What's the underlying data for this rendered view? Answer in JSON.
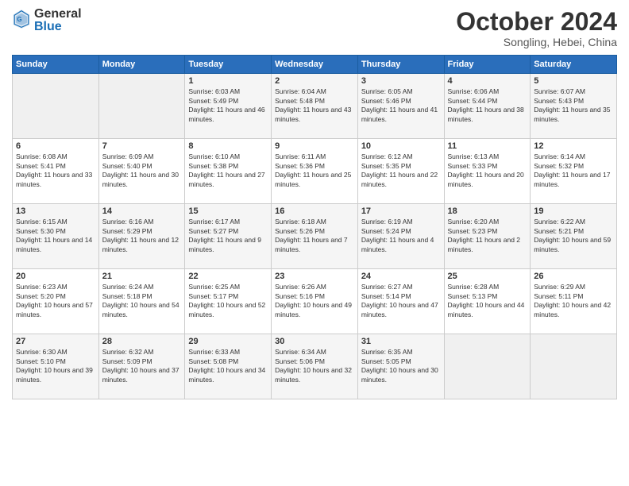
{
  "logo": {
    "general": "General",
    "blue": "Blue"
  },
  "title": "October 2024",
  "location": "Songling, Hebei, China",
  "days_header": [
    "Sunday",
    "Monday",
    "Tuesday",
    "Wednesday",
    "Thursday",
    "Friday",
    "Saturday"
  ],
  "weeks": [
    [
      {
        "day": "",
        "content": ""
      },
      {
        "day": "",
        "content": ""
      },
      {
        "day": "1",
        "content": "Sunrise: 6:03 AM\nSunset: 5:49 PM\nDaylight: 11 hours and 46 minutes."
      },
      {
        "day": "2",
        "content": "Sunrise: 6:04 AM\nSunset: 5:48 PM\nDaylight: 11 hours and 43 minutes."
      },
      {
        "day": "3",
        "content": "Sunrise: 6:05 AM\nSunset: 5:46 PM\nDaylight: 11 hours and 41 minutes."
      },
      {
        "day": "4",
        "content": "Sunrise: 6:06 AM\nSunset: 5:44 PM\nDaylight: 11 hours and 38 minutes."
      },
      {
        "day": "5",
        "content": "Sunrise: 6:07 AM\nSunset: 5:43 PM\nDaylight: 11 hours and 35 minutes."
      }
    ],
    [
      {
        "day": "6",
        "content": "Sunrise: 6:08 AM\nSunset: 5:41 PM\nDaylight: 11 hours and 33 minutes."
      },
      {
        "day": "7",
        "content": "Sunrise: 6:09 AM\nSunset: 5:40 PM\nDaylight: 11 hours and 30 minutes."
      },
      {
        "day": "8",
        "content": "Sunrise: 6:10 AM\nSunset: 5:38 PM\nDaylight: 11 hours and 27 minutes."
      },
      {
        "day": "9",
        "content": "Sunrise: 6:11 AM\nSunset: 5:36 PM\nDaylight: 11 hours and 25 minutes."
      },
      {
        "day": "10",
        "content": "Sunrise: 6:12 AM\nSunset: 5:35 PM\nDaylight: 11 hours and 22 minutes."
      },
      {
        "day": "11",
        "content": "Sunrise: 6:13 AM\nSunset: 5:33 PM\nDaylight: 11 hours and 20 minutes."
      },
      {
        "day": "12",
        "content": "Sunrise: 6:14 AM\nSunset: 5:32 PM\nDaylight: 11 hours and 17 minutes."
      }
    ],
    [
      {
        "day": "13",
        "content": "Sunrise: 6:15 AM\nSunset: 5:30 PM\nDaylight: 11 hours and 14 minutes."
      },
      {
        "day": "14",
        "content": "Sunrise: 6:16 AM\nSunset: 5:29 PM\nDaylight: 11 hours and 12 minutes."
      },
      {
        "day": "15",
        "content": "Sunrise: 6:17 AM\nSunset: 5:27 PM\nDaylight: 11 hours and 9 minutes."
      },
      {
        "day": "16",
        "content": "Sunrise: 6:18 AM\nSunset: 5:26 PM\nDaylight: 11 hours and 7 minutes."
      },
      {
        "day": "17",
        "content": "Sunrise: 6:19 AM\nSunset: 5:24 PM\nDaylight: 11 hours and 4 minutes."
      },
      {
        "day": "18",
        "content": "Sunrise: 6:20 AM\nSunset: 5:23 PM\nDaylight: 11 hours and 2 minutes."
      },
      {
        "day": "19",
        "content": "Sunrise: 6:22 AM\nSunset: 5:21 PM\nDaylight: 10 hours and 59 minutes."
      }
    ],
    [
      {
        "day": "20",
        "content": "Sunrise: 6:23 AM\nSunset: 5:20 PM\nDaylight: 10 hours and 57 minutes."
      },
      {
        "day": "21",
        "content": "Sunrise: 6:24 AM\nSunset: 5:18 PM\nDaylight: 10 hours and 54 minutes."
      },
      {
        "day": "22",
        "content": "Sunrise: 6:25 AM\nSunset: 5:17 PM\nDaylight: 10 hours and 52 minutes."
      },
      {
        "day": "23",
        "content": "Sunrise: 6:26 AM\nSunset: 5:16 PM\nDaylight: 10 hours and 49 minutes."
      },
      {
        "day": "24",
        "content": "Sunrise: 6:27 AM\nSunset: 5:14 PM\nDaylight: 10 hours and 47 minutes."
      },
      {
        "day": "25",
        "content": "Sunrise: 6:28 AM\nSunset: 5:13 PM\nDaylight: 10 hours and 44 minutes."
      },
      {
        "day": "26",
        "content": "Sunrise: 6:29 AM\nSunset: 5:11 PM\nDaylight: 10 hours and 42 minutes."
      }
    ],
    [
      {
        "day": "27",
        "content": "Sunrise: 6:30 AM\nSunset: 5:10 PM\nDaylight: 10 hours and 39 minutes."
      },
      {
        "day": "28",
        "content": "Sunrise: 6:32 AM\nSunset: 5:09 PM\nDaylight: 10 hours and 37 minutes."
      },
      {
        "day": "29",
        "content": "Sunrise: 6:33 AM\nSunset: 5:08 PM\nDaylight: 10 hours and 34 minutes."
      },
      {
        "day": "30",
        "content": "Sunrise: 6:34 AM\nSunset: 5:06 PM\nDaylight: 10 hours and 32 minutes."
      },
      {
        "day": "31",
        "content": "Sunrise: 6:35 AM\nSunset: 5:05 PM\nDaylight: 10 hours and 30 minutes."
      },
      {
        "day": "",
        "content": ""
      },
      {
        "day": "",
        "content": ""
      }
    ]
  ]
}
